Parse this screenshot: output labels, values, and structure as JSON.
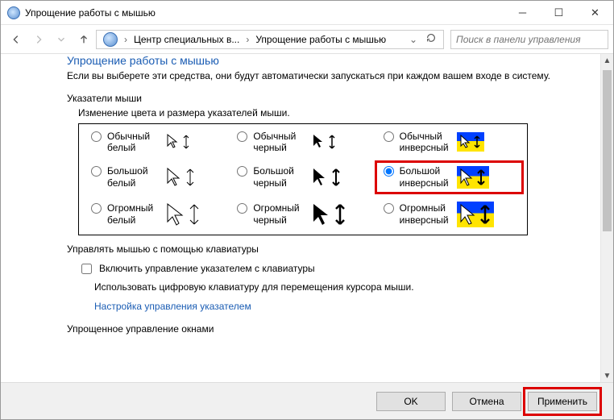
{
  "window": {
    "title": "Упрощение работы с мышью"
  },
  "breadcrumb": {
    "seg1": "Центр специальных в...",
    "seg2": "Упрощение работы с мышью"
  },
  "search": {
    "placeholder": "Поиск в панели управления"
  },
  "page": {
    "title": "Упрощение работы с мышью",
    "intro": "Если вы выберете эти средства, они будут автоматически запускаться при каждом вашем входе в систему."
  },
  "pointers": {
    "section": "Указатели мыши",
    "sublabel": "Изменение цвета и размера указателей мыши.",
    "options": {
      "white_normal": "Обычный белый",
      "black_normal": "Обычный черный",
      "inv_normal": "Обычный инверсный",
      "white_large": "Большой белый",
      "black_large": "Большой черный",
      "inv_large": "Большой инверсный",
      "white_huge": "Огромный белый",
      "black_huge": "Огромный черный",
      "inv_huge": "Огромный инверсный"
    }
  },
  "keyboard": {
    "section": "Управлять мышью с помощью клавиатуры",
    "checkbox": "Включить управление указателем с клавиатуры",
    "hint": "Использовать цифровую клавиатуру для перемещения курсора мыши.",
    "link": "Настройка управления указателем"
  },
  "windows_section": "Упрощенное управление окнами",
  "footer": {
    "ok": "OK",
    "cancel": "Отмена",
    "apply": "Применить"
  }
}
